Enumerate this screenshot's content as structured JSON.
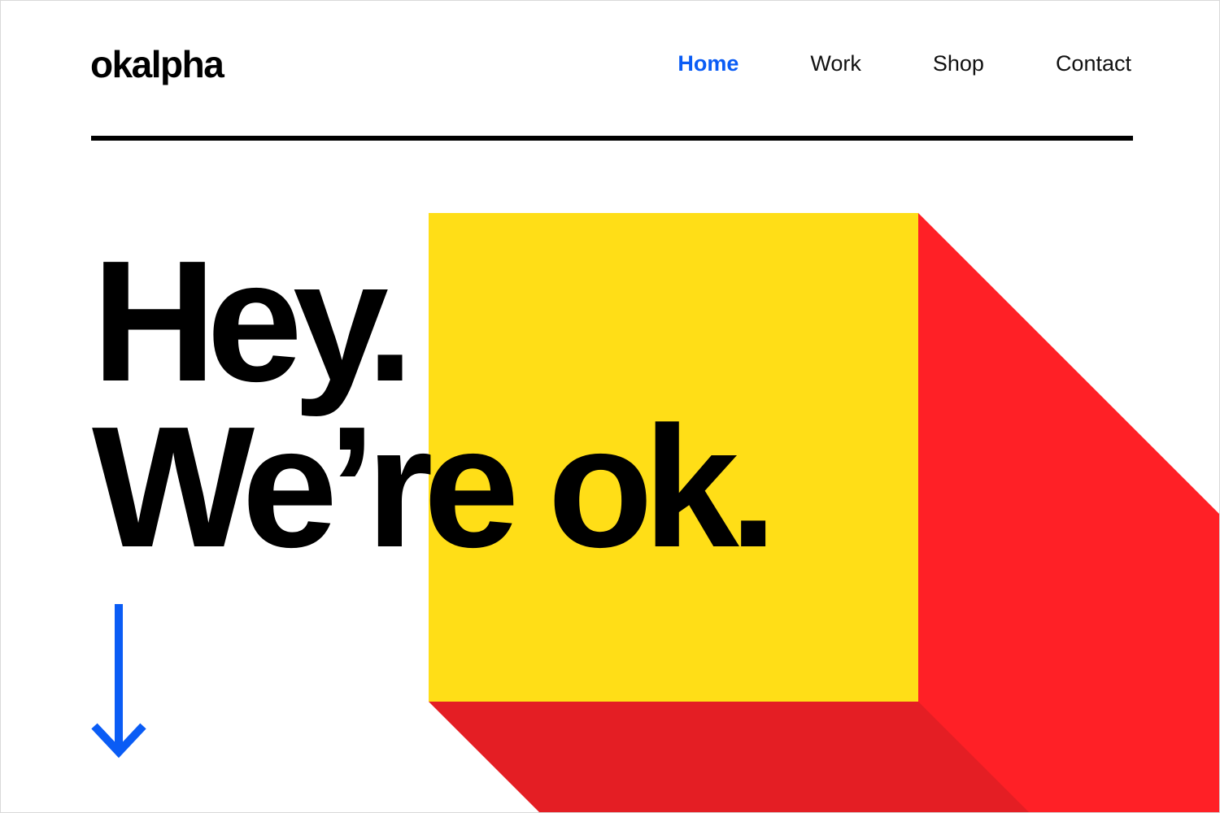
{
  "brand": {
    "logo_text": "okalpha"
  },
  "nav": {
    "items": [
      {
        "label": "Home",
        "active": true
      },
      {
        "label": "Work",
        "active": false
      },
      {
        "label": "Shop",
        "active": false
      },
      {
        "label": "Contact",
        "active": false
      }
    ]
  },
  "hero": {
    "line1": "Hey.",
    "line2": "We’re ok."
  },
  "icons": {
    "scroll": "arrow-down-icon"
  },
  "colors": {
    "accent_blue": "#0a5cf5",
    "cube_front_yellow": "#ffde17",
    "cube_side_red": "#ff2026",
    "cube_bottom_red": "#e41e24",
    "text": "#000000",
    "background": "#ffffff"
  }
}
